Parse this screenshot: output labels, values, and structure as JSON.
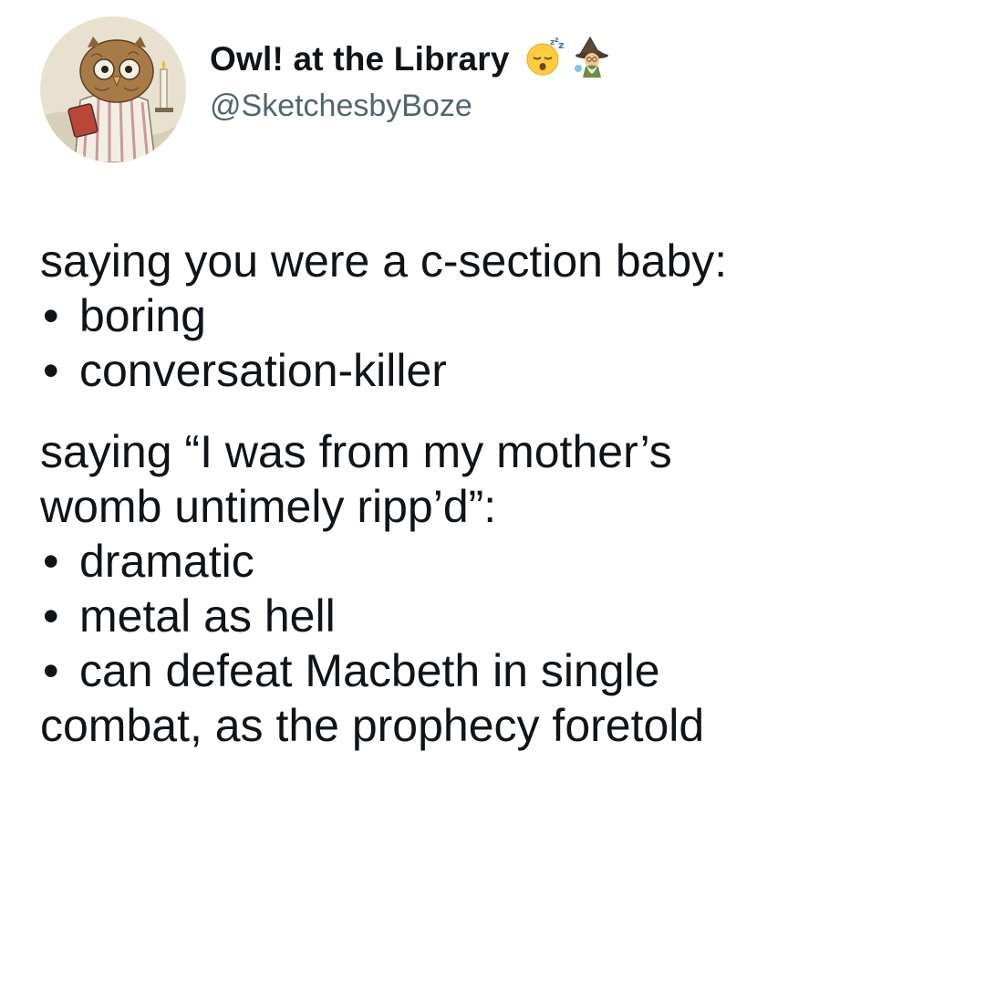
{
  "author": {
    "display_name": "Owl! at the Library",
    "handle": "@SketchesbyBoze",
    "emoji_badges": [
      "sleeping-face-icon",
      "mage-icon"
    ]
  },
  "tweet": {
    "section1": {
      "heading": "saying you were a c-section baby:",
      "bullets": [
        "boring",
        "conversation-killer"
      ]
    },
    "section2": {
      "heading_line1": "saying “I was from my mother’s",
      "heading_line2": "womb untimely ripp’d”:",
      "bullets": [
        "dramatic",
        "metal as hell",
        "can defeat Macbeth in single"
      ],
      "continuation": "combat, as the prophecy foretold"
    },
    "bullet_symbol": "•"
  },
  "colors": {
    "text": "#0f1419",
    "handle": "#536471",
    "background": "#ffffff"
  }
}
